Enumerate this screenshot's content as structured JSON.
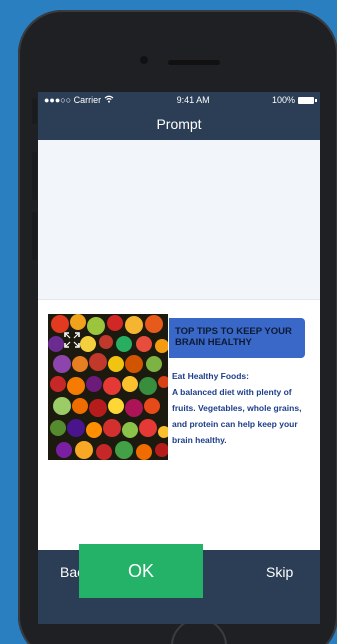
{
  "status": {
    "carrier": "●●●○○ Carrier",
    "time": "9:41 AM",
    "battery": "100%"
  },
  "nav": {
    "title": "Prompt"
  },
  "card": {
    "headline": "TOP TIPS TO KEEP YOUR BRAIN HEALTHY",
    "tip_title": "Eat Healthy Foods:",
    "tip_body": "A balanced diet with plenty of fruits. Vegetables, whole grains, and protein can help keep your brain healthy."
  },
  "actions": {
    "back": "Back",
    "ok": "OK",
    "skip": "Skip"
  }
}
